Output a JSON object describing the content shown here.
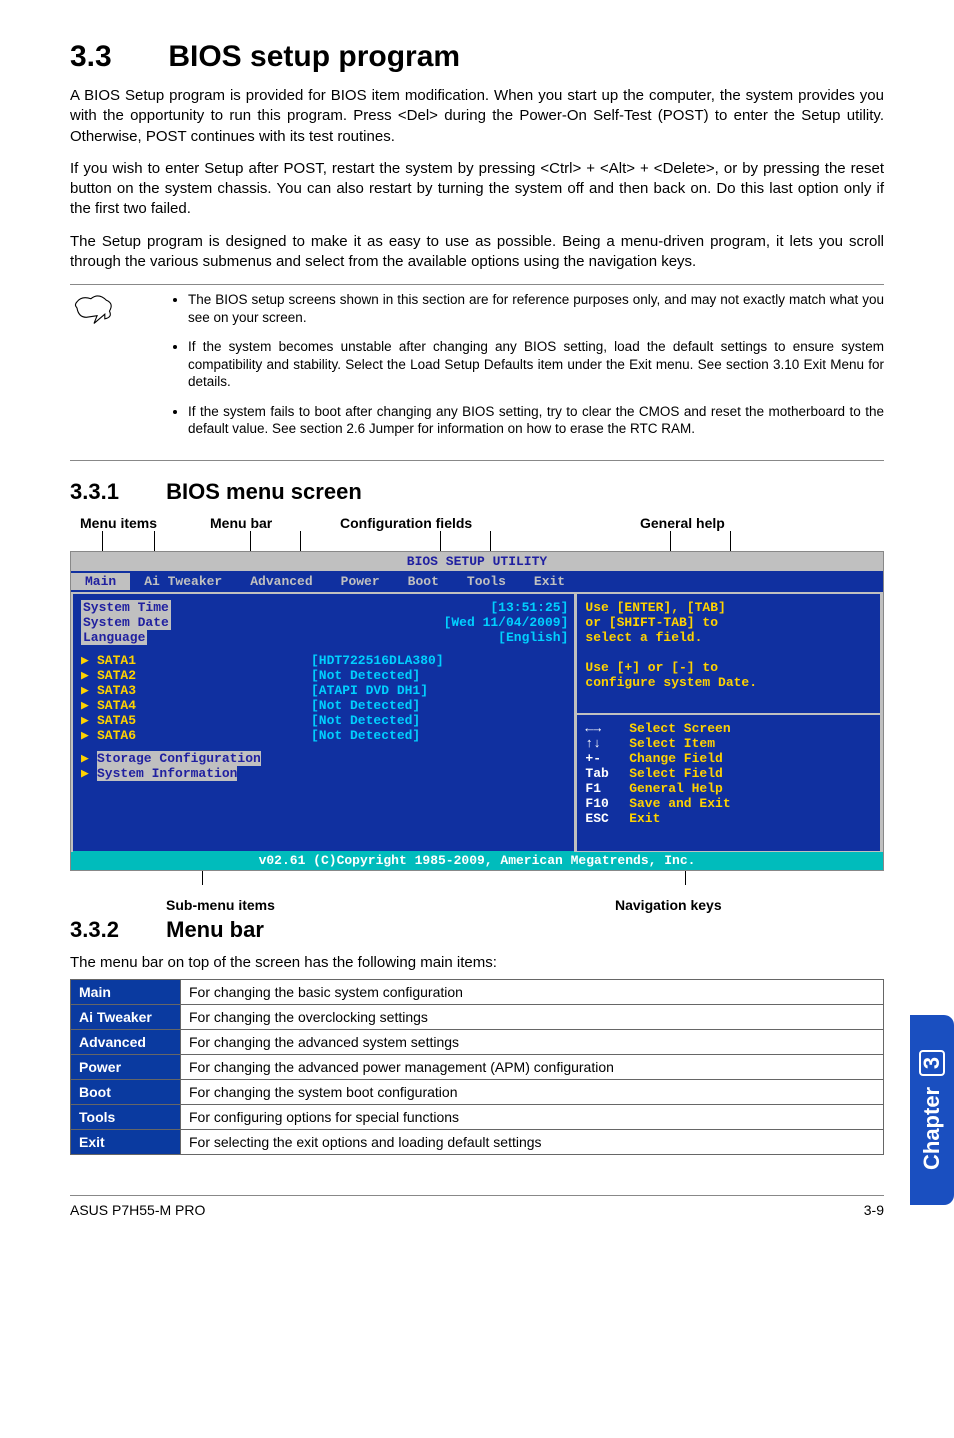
{
  "section": {
    "num": "3.3",
    "title": "BIOS setup program"
  },
  "para1": "A BIOS Setup program is provided for BIOS item modification. When you start up the computer, the system provides you with the opportunity to run this program. Press <Del> during the Power-On Self-Test (POST) to enter the Setup utility. Otherwise, POST continues with its test routines.",
  "para2": "If you wish to enter Setup after POST, restart the system by pressing <Ctrl> + <Alt> + <Delete>, or by pressing the reset button on the system chassis. You can also restart by turning the system off and then back on. Do this last option only if the first two failed.",
  "para3": "The Setup program is designed to make it as easy to use as possible. Being a menu-driven program, it lets you scroll through the various submenus and select from the available options using the navigation keys.",
  "notes": [
    "The BIOS setup screens shown in this section are for reference purposes only, and may not exactly match what you see on your screen.",
    "If the system becomes unstable after changing any BIOS setting, load the default settings to ensure system compatibility and stability. Select the Load Setup Defaults item under the Exit menu. See section 3.10 Exit Menu for details.",
    "If the system fails to boot after changing any BIOS setting, try to clear the CMOS and reset the motherboard to the default value. See section 2.6 Jumper for information on how to erase the RTC RAM."
  ],
  "sub1": {
    "num": "3.3.1",
    "title": "BIOS menu screen"
  },
  "labels": {
    "menu_items": "Menu items",
    "menu_bar": "Menu bar",
    "config_fields": "Configuration fields",
    "general_help": "General help",
    "sub_menu": "Sub-menu items",
    "nav_keys": "Navigation keys"
  },
  "bios": {
    "title": "BIOS SETUP UTILITY",
    "tabs": [
      "Main",
      "Ai Tweaker",
      "Advanced",
      "Power",
      "Boot",
      "Tools",
      "Exit"
    ],
    "selected_tab": "Main",
    "left": {
      "rows": [
        {
          "key": "System Time",
          "val": "[13:51:25]",
          "sel": true
        },
        {
          "key": "System Date",
          "val": "[Wed 11/04/2009]",
          "sel": true
        },
        {
          "key": "Language",
          "val": "[English]",
          "sel": true
        }
      ],
      "sata": [
        {
          "key": "SATA1",
          "val": "[HDT722516DLA380]"
        },
        {
          "key": "SATA2",
          "val": "[Not Detected]"
        },
        {
          "key": "SATA3",
          "val": "[ATAPI DVD DH1]"
        },
        {
          "key": "SATA4",
          "val": "[Not Detected]"
        },
        {
          "key": "SATA5",
          "val": "[Not Detected]"
        },
        {
          "key": "SATA6",
          "val": "[Not Detected]"
        }
      ],
      "subs": [
        "Storage Configuration",
        "System Information"
      ]
    },
    "help": {
      "line1": "Use [ENTER], [TAB]",
      "line2": "or [SHIFT-TAB] to",
      "line3": "select a field.",
      "blank": "",
      "line4": "Use [+] or [-] to",
      "line5": "configure system Date."
    },
    "nav": [
      {
        "k": "←→",
        "t": "Select Screen"
      },
      {
        "k": "↑↓",
        "t": "Select Item"
      },
      {
        "k": "+-",
        "t": "Change Field"
      },
      {
        "k": "Tab",
        "t": "Select Field"
      },
      {
        "k": "F1",
        "t": "General Help"
      },
      {
        "k": "F10",
        "t": "Save and Exit"
      },
      {
        "k": "ESC",
        "t": "Exit"
      }
    ],
    "footer": "v02.61 (C)Copyright 1985-2009, American Megatrends, Inc."
  },
  "sub2": {
    "num": "3.3.2",
    "title": "Menu bar"
  },
  "menubar_intro": "The menu bar on top of the screen has the following main items:",
  "main_items": [
    {
      "name": "Main",
      "desc": "For changing the basic system configuration"
    },
    {
      "name": "Ai Tweaker",
      "desc": "For changing the overclocking settings"
    },
    {
      "name": "Advanced",
      "desc": "For changing the advanced system settings"
    },
    {
      "name": "Power",
      "desc": "For changing the advanced power management (APM) configuration"
    },
    {
      "name": "Boot",
      "desc": "For changing the system boot configuration"
    },
    {
      "name": "Tools",
      "desc": "For configuring options for special functions"
    },
    {
      "name": "Exit",
      "desc": "For selecting the exit options and loading default settings"
    }
  ],
  "side_tab": "Chapter",
  "side_tab_num": "3",
  "footer": {
    "left": "ASUS P7H55-M PRO",
    "right": "3-9"
  }
}
